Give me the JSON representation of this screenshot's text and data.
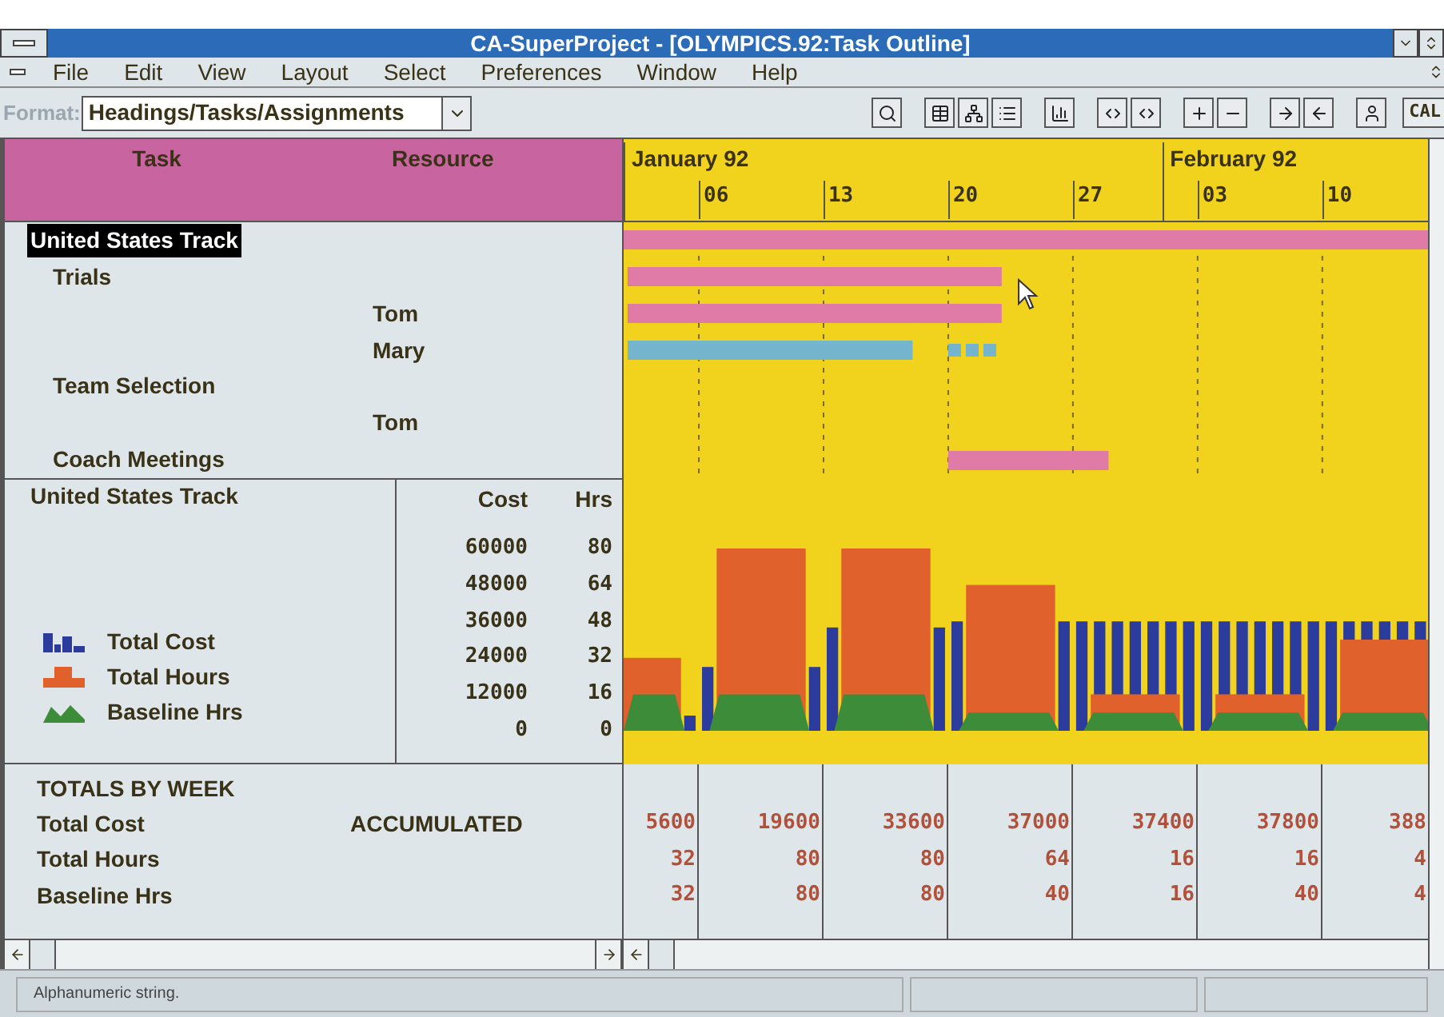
{
  "window": {
    "title": "CA-SuperProject - [OLYMPICS.92:Task Outline]"
  },
  "menu": [
    "File",
    "Edit",
    "View",
    "Layout",
    "Select",
    "Preferences",
    "Window",
    "Help"
  ],
  "toolbar": {
    "format_label": "Format:",
    "format_value": "Headings/Tasks/Assignments",
    "calc": "CAL"
  },
  "columns": {
    "task": "Task",
    "resource": "Resource"
  },
  "timeline": {
    "months": [
      "January 92",
      "February 92"
    ],
    "weeks": [
      "06",
      "13",
      "20",
      "27",
      "03",
      "10"
    ]
  },
  "outline": [
    {
      "kind": "summary",
      "task": "United States Track",
      "selected": true,
      "bars": [
        {
          "kind": "solid",
          "color": "#e07aa6"
        }
      ]
    },
    {
      "kind": "task",
      "task": "Trials",
      "selected": false,
      "bars": [
        {
          "kind": "solid",
          "color": "#e07aa6"
        }
      ]
    },
    {
      "kind": "assignment",
      "resource": "Tom",
      "selected": false,
      "bars": [
        {
          "kind": "solid",
          "color": "#e07aa6"
        }
      ]
    },
    {
      "kind": "assignment",
      "resource": "Mary",
      "selected": false,
      "bars": [
        {
          "kind": "solid",
          "color": "#74b4cc"
        },
        {
          "kind": "dashed",
          "color": "#74b4cc"
        }
      ]
    },
    {
      "kind": "task",
      "task": "Team Selection",
      "selected": false
    },
    {
      "kind": "assignment",
      "resource": "Tom",
      "selected": false
    },
    {
      "kind": "task",
      "task": "Coach Meetings",
      "selected": false,
      "bars": [
        {
          "kind": "solid",
          "color": "#e07aa6"
        }
      ]
    }
  ],
  "histogram": {
    "title": "United States Track",
    "cost_label": "Cost",
    "hrs_label": "Hrs",
    "legend": [
      {
        "kind": "cost",
        "label": "Total Cost"
      },
      {
        "kind": "hours",
        "label": "Total Hours"
      },
      {
        "kind": "baseline",
        "label": "Baseline Hrs"
      }
    ],
    "axis": [
      {
        "cost": "60000",
        "hrs": "80"
      },
      {
        "cost": "48000",
        "hrs": "64"
      },
      {
        "cost": "36000",
        "hrs": "48"
      },
      {
        "cost": "24000",
        "hrs": "32"
      },
      {
        "cost": "12000",
        "hrs": "16"
      },
      {
        "cost": "0",
        "hrs": "0"
      }
    ]
  },
  "totals": {
    "title": "TOTALS BY WEEK",
    "accumulated": "ACCUMULATED",
    "rows": [
      {
        "label": "Total Cost",
        "values": [
          "5600",
          "19600",
          "33600",
          "37000",
          "37400",
          "37800",
          "388"
        ]
      },
      {
        "label": "Total Hours",
        "values": [
          "32",
          "80",
          "80",
          "64",
          "16",
          "16",
          "4"
        ]
      },
      {
        "label": "Baseline Hrs",
        "values": [
          "32",
          "80",
          "80",
          "40",
          "16",
          "40",
          "4"
        ]
      }
    ]
  },
  "status_bar": {
    "message": "Alphanumeric string."
  }
}
